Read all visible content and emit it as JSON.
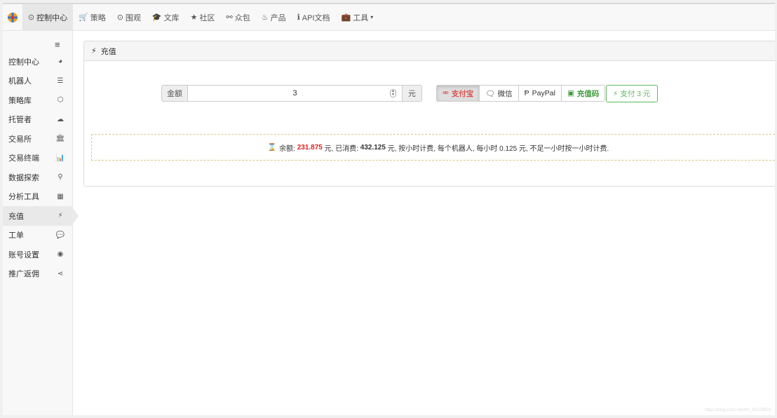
{
  "topnav": {
    "active_label": "控制中心",
    "items": [
      {
        "icon": "shopping-cart-icon",
        "glyph": "🛒",
        "label": "策略"
      },
      {
        "icon": "eye-circle-icon",
        "glyph": "⊙",
        "label": "围观"
      },
      {
        "icon": "graduation-cap-icon",
        "glyph": "🎓",
        "label": "文库"
      },
      {
        "icon": "star-icon",
        "glyph": "★",
        "label": "社区"
      },
      {
        "icon": "binoculars-icon",
        "glyph": "⚯",
        "label": "众包"
      },
      {
        "icon": "fire-icon",
        "glyph": "♨",
        "label": "产品"
      },
      {
        "icon": "info-circle-icon",
        "glyph": "ℹ",
        "label": "API文档"
      },
      {
        "icon": "briefcase-icon",
        "glyph": "💼",
        "label": "工具"
      }
    ]
  },
  "sidebar": {
    "items": [
      {
        "label": "控制中心",
        "icon": "dashboard-icon",
        "glyph": "◕"
      },
      {
        "label": "机器人",
        "icon": "server-icon",
        "glyph": "☰"
      },
      {
        "label": "策略库",
        "icon": "cube-icon",
        "glyph": "⬡"
      },
      {
        "label": "托管者",
        "icon": "cloud-icon",
        "glyph": "☁"
      },
      {
        "label": "交易所",
        "icon": "bank-icon",
        "glyph": "🏛"
      },
      {
        "label": "交易终端",
        "icon": "bar-chart-icon",
        "glyph": "📊"
      },
      {
        "label": "数据探索",
        "icon": "search-icon",
        "glyph": "⚲"
      },
      {
        "label": "分析工具",
        "icon": "calculator-icon",
        "glyph": "▦"
      },
      {
        "label": "充值",
        "icon": "plug-icon",
        "glyph": "⚡"
      },
      {
        "label": "工单",
        "icon": "comment-icon",
        "glyph": "💬"
      },
      {
        "label": "账号设置",
        "icon": "user-circle-icon",
        "glyph": "◉"
      },
      {
        "label": "推广返佣",
        "icon": "share-icon",
        "glyph": "⋖"
      }
    ],
    "active_index": 8
  },
  "panel": {
    "title": "充值",
    "amount_label": "金额",
    "amount_value": "3",
    "unit": "元",
    "pay_methods": [
      {
        "label": "支付宝",
        "icon": "alipay-icon",
        "glyph": "⚮",
        "selected": true
      },
      {
        "label": "微信",
        "icon": "wechat-icon",
        "glyph": "🗨",
        "selected": false
      },
      {
        "label": "PayPal",
        "icon": "paypal-icon",
        "glyph": "Ᵽ",
        "selected": false
      },
      {
        "label": "充值码",
        "icon": "money-icon",
        "glyph": "▣",
        "selected": false
      }
    ],
    "submit_label": "支付 3 元",
    "balance": {
      "prefix": "余额:",
      "balance_value": "231.875",
      "mid1": "元, 已消费:",
      "spent_value": "432.125",
      "suffix": "元, 按小时计费, 每个机器人, 每小时 0.125 元, 不足一小时按一小时计费."
    }
  },
  "watermark": "https://blog.csdn.net/m0_46159959",
  "colors": {
    "accent_red": "#e02020",
    "success_green": "#5cb85c",
    "dashed_border": "#e3c58a"
  }
}
